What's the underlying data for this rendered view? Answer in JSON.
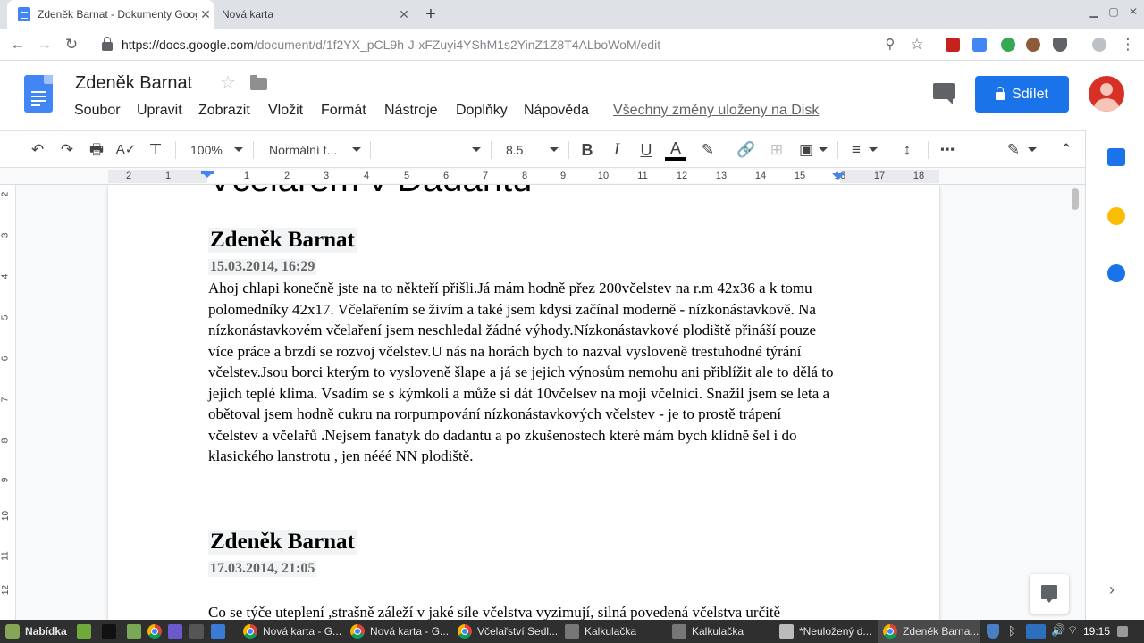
{
  "browser": {
    "tabs": [
      {
        "title": "Zdeněk Barnat - Dokumenty Google",
        "active": true
      },
      {
        "title": "Nová karta",
        "active": false
      }
    ],
    "new_tab_symbol": "+",
    "url_host": "https://docs.google.com",
    "url_path": "/document/d/1f2YX_pCL9h-J-xFZuyi4YShM1s2YinZ1Z8T4ALboWoM/edit"
  },
  "docs": {
    "title": "Zdeněk Barnat",
    "menu": [
      "Soubor",
      "Upravit",
      "Zobrazit",
      "Vložit",
      "Formát",
      "Nástroje",
      "Doplňky",
      "Nápověda"
    ],
    "save_status": "Všechny změny uloženy na Disk",
    "share_label": "Sdílet"
  },
  "toolbar": {
    "zoom": "100%",
    "style": "Normální t...",
    "font": "",
    "font_size": "8.5",
    "bold": "B",
    "italic": "I",
    "underline": "U",
    "text_color": "A",
    "more": "⋯"
  },
  "ruler": {
    "numbers": [
      "2",
      "1",
      "1",
      "2",
      "3",
      "4",
      "5",
      "6",
      "7",
      "8",
      "9",
      "10",
      "11",
      "12",
      "13",
      "14",
      "15",
      "16",
      "17",
      "18"
    ]
  },
  "vruler": {
    "numbers": [
      "2",
      "3",
      "4",
      "5",
      "6",
      "7",
      "8",
      "9",
      "10",
      "11",
      "12"
    ]
  },
  "document": {
    "cut_heading": "Včelařem v Dadantu",
    "posts": [
      {
        "author": "Zdeněk Barnat",
        "date": "15.03.2014, 16:29",
        "body": "Ahoj chlapi konečně jste na to někteří přišli.Já mám hodně přez 200včelstev na r.m 42x36 a k tomu polomedníky 42x17. Včelařením se živím a také jsem kdysi začínal moderně - nízkonástavkově. Na nízkonástavkovém včelaření jsem neschledal žádné výhody.Nízkonástavkové plodiště přináší pouze více práce a brzdí se rozvoj včelstev.U nás na horách bych to nazval vysloveně trestuhodné týrání včelstev.Jsou borci kterým to vysloveně šlape a já se jejich výnosům nemohu ani přiblížit ale to dělá to jejich teplé klima. Vsadím se s kýmkoli a může si dát 10včelsev na moji včelnici. Snažil jsem se leta a obětoval jsem hodně cukru na rorpumpování nízkonástavkových včelstev - je to prostě trápení včelstev a včelařů .Nejsem fanatyk do dadantu a po zkušenostech které mám bych klidně šel i do klasického lanstrotu , jen nééé NN plodiště."
      },
      {
        "author": "Zdeněk Barnat",
        "date": "17.03.2014, 21:05",
        "body": "Co se týče uteplení ,strašně záleží v jaké síle včelstva vyzimují, silná povedená včelstva určitě"
      }
    ]
  },
  "taskbar": {
    "menu_label": "Nabídka",
    "windows": [
      {
        "title": "Nová karta - G...",
        "active": false
      },
      {
        "title": "Nová karta - G...",
        "active": false
      },
      {
        "title": "Včelařství Sedl...",
        "active": false
      },
      {
        "title": "Kalkulačka",
        "active": false
      },
      {
        "title": "Kalkulačka",
        "active": false
      },
      {
        "title": "*Neuložený d...",
        "active": false
      },
      {
        "title": "Zdeněk Barna...",
        "active": true
      }
    ],
    "clock": "19:15"
  },
  "colors": {
    "accent": "#1a73e8",
    "docs_blue": "#4285f4",
    "avatar": "#d93025",
    "taskbar": "#2f2f2f"
  }
}
